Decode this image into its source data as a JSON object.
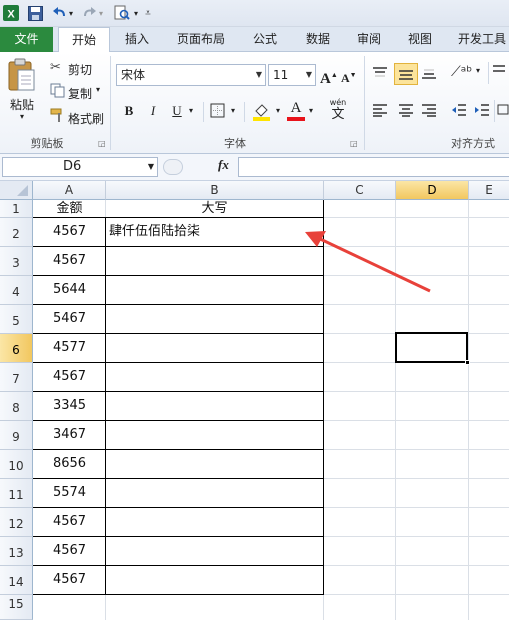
{
  "quick_access": {
    "icons": [
      "excel-logo-icon",
      "save-icon",
      "undo-icon",
      "redo-icon",
      "print-preview-icon",
      "customize-icon"
    ]
  },
  "tabs": {
    "file": "文件",
    "home": "开始",
    "insert": "插入",
    "page_layout": "页面布局",
    "formulas": "公式",
    "data": "数据",
    "review": "审阅",
    "view": "视图",
    "developer": "开发工具"
  },
  "ribbon": {
    "clipboard": {
      "paste": "粘贴",
      "cut": "剪切",
      "copy": "复制",
      "format_painter": "格式刷",
      "label": "剪贴板"
    },
    "font": {
      "font_name": "宋体",
      "font_size": "11",
      "bold": "B",
      "italic": "I",
      "underline": "U",
      "font_color_glyph": "A",
      "phonetic_glyph": "wén",
      "phonetic_char": "文",
      "label": "字体"
    },
    "alignment": {
      "label": "对齐方式"
    }
  },
  "formula_bar": {
    "name_box": "D6",
    "fx": "fx",
    "formula": ""
  },
  "sheet": {
    "columns": [
      "A",
      "B",
      "C",
      "D",
      "E"
    ],
    "selected_column": "D",
    "rows": [
      "1",
      "2",
      "3",
      "4",
      "5",
      "6",
      "7",
      "8",
      "9",
      "10",
      "11",
      "12",
      "13",
      "14",
      "15"
    ],
    "selected_row": "6",
    "header_row": {
      "a": "金额",
      "b": "大写"
    },
    "amounts": [
      "4567",
      "4567",
      "5644",
      "5467",
      "4577",
      "4567",
      "3345",
      "3467",
      "8656",
      "5574",
      "4567",
      "4567",
      "4567"
    ],
    "b2_text": "肆仟伍佰陆拾柒",
    "active_cell": "D6"
  },
  "colors": {
    "file_tab": "#2b8a3e",
    "selection_header": "#f2c75f",
    "arrow": "#e8413a",
    "font_color_bar": "#e8131b",
    "highlight_bar": "#ffe400"
  }
}
